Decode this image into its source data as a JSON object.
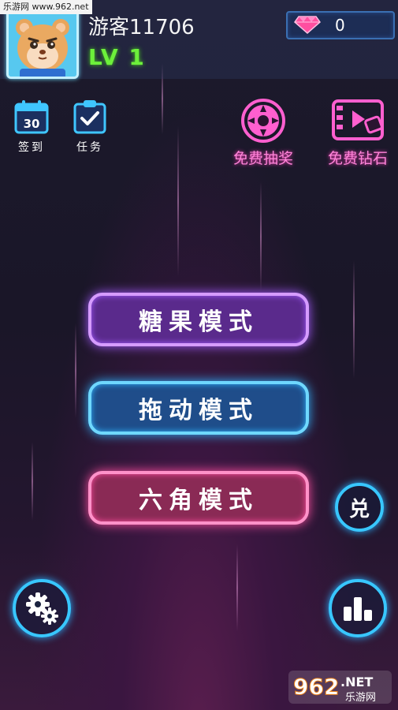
{
  "watermark_top": "乐游网 www.962.net",
  "player": {
    "name": "游客11706",
    "level": "LV 1"
  },
  "currency": {
    "gem_count": "0",
    "gem_color": "#ff4fa0"
  },
  "left_icons": [
    {
      "label": "签到",
      "icon": "calendar-icon",
      "badge": "30"
    },
    {
      "label": "任务",
      "icon": "task-clipboard-icon"
    }
  ],
  "right_icons": [
    {
      "label": "免费抽奖",
      "icon": "prize-wheel-icon"
    },
    {
      "label": "免费钻石",
      "icon": "video-reward-icon"
    }
  ],
  "modes": [
    {
      "label": "糖果模式",
      "color": "#a45cff"
    },
    {
      "label": "拖动模式",
      "color": "#2fb4ff"
    },
    {
      "label": "六角模式",
      "color": "#ff4fa0"
    }
  ],
  "exchange": {
    "label": "兑"
  },
  "bottom": {
    "settings_icon": "gears-icon",
    "leaderboard_icon": "leaderboard-bars-icon"
  },
  "watermark_bottom": {
    "brand": "962",
    "suffix": ".NET",
    "sub": "乐游网"
  }
}
